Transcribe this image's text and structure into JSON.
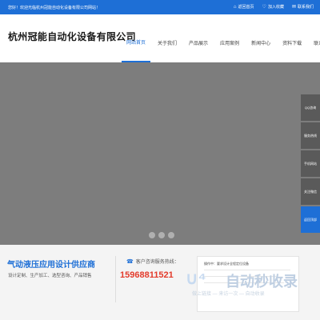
{
  "topbar": {
    "welcome": "您好！欢迎光临杭州冠能自动化设备有限公司网站！",
    "links": [
      {
        "icon": "home-icon",
        "glyph": "⌂",
        "label": "返回首页"
      },
      {
        "icon": "heart-icon",
        "glyph": "♡",
        "label": "加入收藏"
      },
      {
        "icon": "mail-icon",
        "glyph": "✉",
        "label": "联系我们"
      }
    ]
  },
  "header": {
    "logo": "杭州冠能自动化设备有限公司",
    "nav": [
      "网站首页",
      "关于我们",
      "产品展示",
      "应用案例",
      "新闻中心",
      "资料下载",
      "联系我们"
    ],
    "active_nav": 0
  },
  "banner": {
    "dot_count": 3
  },
  "sidebar": {
    "items": [
      "QQ咨询",
      "服务热线",
      "手机网站",
      "关注微信",
      "返回顶部"
    ],
    "active": 4
  },
  "bottom": {
    "slogan": "气动液压应用设计供应商",
    "services": "设计定制、生产加工、选型咨询、产品销售",
    "contact_label": "客户咨询服务热线：",
    "phone": "15968811521",
    "card_text": "操作中：要求设计全程定位设备"
  },
  "watermark": {
    "text": "自动秒收录",
    "sub": "做上链接 — 来访一次 — 自动收录"
  },
  "colors": {
    "accent": "#1e6fd6",
    "phone": "#e33b2b",
    "banner": "#7d7d7d",
    "sidebar": "#5a5a5a"
  }
}
